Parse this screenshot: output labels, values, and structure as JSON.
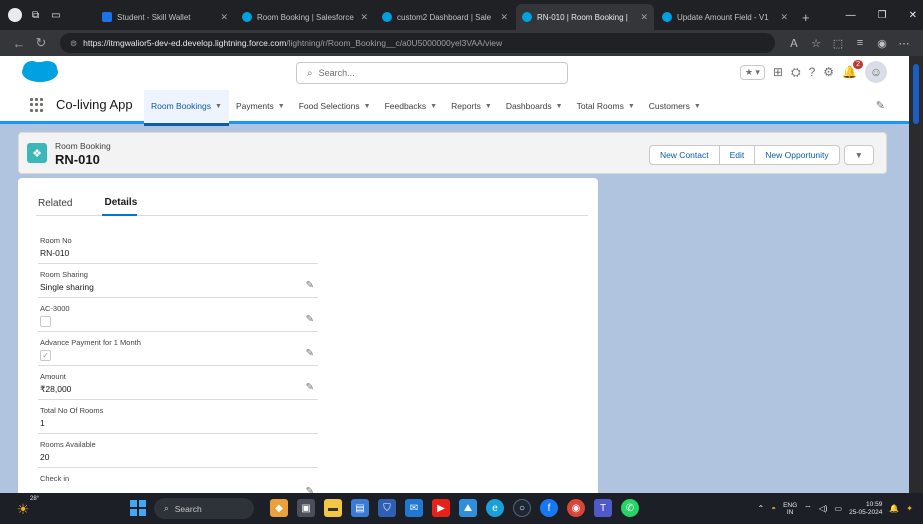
{
  "browser": {
    "tabs": [
      {
        "title": "Student - Skill Wallet",
        "color": "#1a73e8"
      },
      {
        "title": "Room Booking | Salesforce",
        "color": "#00a1e0"
      },
      {
        "title": "custom2 Dashboard | Sale",
        "color": "#00a1e0"
      },
      {
        "title": "RN-010 | Room Booking |",
        "color": "#00a1e0"
      },
      {
        "title": "Update Amount Field - V1",
        "color": "#00a1e0"
      }
    ],
    "active_tab": 3,
    "new_tab": "+",
    "url_host": "https://itmgwalior5-dev-ed.develop.lightning.force.com",
    "url_path": "/lightning/r/Room_Booking__c/a0U5000000yel3VAA/view"
  },
  "sf": {
    "search_placeholder": "Search...",
    "notification_count": "2",
    "app_name": "Co-living App",
    "nav": [
      {
        "label": "Room Bookings",
        "active": true
      },
      {
        "label": "Payments"
      },
      {
        "label": "Food Selections"
      },
      {
        "label": "Feedbacks"
      },
      {
        "label": "Reports"
      },
      {
        "label": "Dashboards"
      },
      {
        "label": "Total Rooms"
      },
      {
        "label": "Customers"
      }
    ],
    "record": {
      "type": "Room Booking",
      "name": "RN-010",
      "actions": [
        "New Contact",
        "Edit",
        "New Opportunity"
      ]
    },
    "tabs": {
      "related": "Related",
      "details": "Details"
    },
    "fields": [
      {
        "label": "Room No",
        "value": "RN-010",
        "editable": false
      },
      {
        "label": "Room Sharing",
        "value": "Single sharing",
        "editable": true
      },
      {
        "label": "AC-3000",
        "checkbox": true,
        "checked": false,
        "editable": true
      },
      {
        "label": "Advance Payment for 1 Month",
        "checkbox": true,
        "checked": true,
        "editable": true
      },
      {
        "label": "Amount",
        "value": "₹28,000",
        "editable": true
      },
      {
        "label": "Total No Of Rooms",
        "value": "1",
        "editable": false
      },
      {
        "label": "Rooms Available",
        "value": "20",
        "editable": false
      },
      {
        "label": "Check in",
        "value": "",
        "editable": true
      }
    ]
  },
  "taskbar": {
    "temp": "28°",
    "search": "Search",
    "lang_top": "ENG",
    "lang_bottom": "IN",
    "time": "10:59",
    "date": "25-05-2024"
  },
  "colors": {
    "brand": "#0176d3",
    "page_bg": "#b0c4df",
    "record_icon": "#3bb7ba"
  }
}
